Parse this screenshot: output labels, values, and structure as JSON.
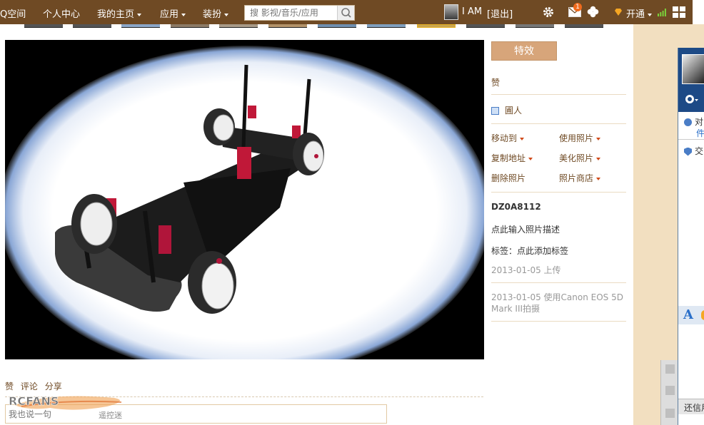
{
  "topbar": {
    "logo": "Q空间",
    "nav": [
      "个人中心",
      "我的主页",
      "应用",
      "装扮"
    ],
    "search_placeholder": "搜 影视/音乐/应用",
    "user_name": "I AM",
    "logout": "[退出]",
    "open_label": "开通",
    "mail_badge": "1"
  },
  "panel": {
    "effect_button": "特效",
    "like": "赞",
    "person": "圃人",
    "actions": [
      "移动到",
      "使用照片",
      "复制地址",
      "美化照片",
      "删除照片",
      "照片商店"
    ],
    "photo_name": "DZ0A8112",
    "desc_prompt": "点此输入照片描述",
    "tag_prompt": "标签：点此添加标签",
    "upload_info": "2013-01-05 上传",
    "camera_info_line1": "2013-01-05 使用Canon EOS 5D",
    "camera_info_line2": "Mark III拍摄"
  },
  "bottom": {
    "links": [
      "赞",
      "评论",
      "分享"
    ],
    "comment_placeholder": "我也说一句"
  },
  "watermark": {
    "brand": "RCFANS",
    "sub": "遥控迷"
  },
  "popup": {
    "line1": "对",
    "line2": "件",
    "line3": "交",
    "bottom": "还信用"
  },
  "colors": {
    "topbar": "#6f4a24",
    "accent_button": "#d7a57a",
    "link": "#6f4a24",
    "beige": "#f2dfc0"
  }
}
